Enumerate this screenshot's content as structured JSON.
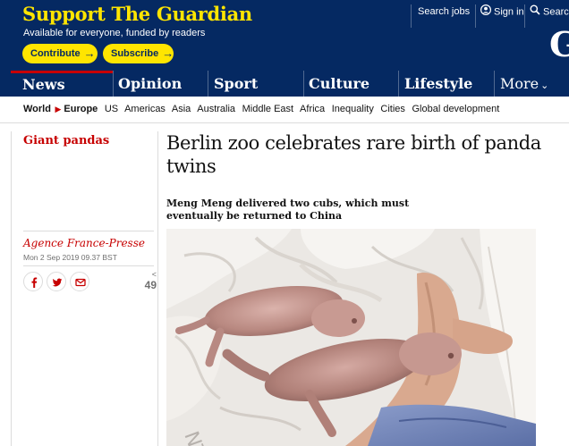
{
  "masthead": {
    "support_title": "Support The Guardian",
    "support_subtitle": "Available for everyone, funded by readers",
    "contribute_label": "Contribute",
    "subscribe_label": "Subscribe",
    "arrow_glyph": "→",
    "search_jobs": "Search jobs",
    "sign_in": "Sign in",
    "search": "Search",
    "logo_letter": "G",
    "colors": {
      "brand": "#052962",
      "accent": "#ffe500",
      "news_red": "#c70000"
    }
  },
  "pillars": {
    "items": [
      {
        "label": "News",
        "active": true
      },
      {
        "label": "Opinion",
        "active": false
      },
      {
        "label": "Sport",
        "active": false
      },
      {
        "label": "Culture",
        "active": false
      },
      {
        "label": "Lifestyle",
        "active": false
      }
    ],
    "more_label": "More",
    "more_icon": "chevron-down-icon"
  },
  "subnav": {
    "world": "World",
    "europe": "Europe",
    "items": [
      "US",
      "Americas",
      "Asia",
      "Australia",
      "Middle East",
      "Africa",
      "Inequality",
      "Cities",
      "Global development"
    ]
  },
  "article": {
    "section": "Giant pandas",
    "headline": "Berlin zoo celebrates rare birth of panda twins",
    "standfirst": "Meng Meng delivered two cubs, which must eventually be returned to China",
    "byline": "Agence France-Presse",
    "dateline": "Mon 2 Sep 2019 09.37 BST",
    "share_count": "49",
    "share_icons": [
      "facebook-icon",
      "twitter-icon",
      "email-icon"
    ]
  },
  "image": {
    "subject": "two newborn panda cubs on a white towel held by a gloved hand",
    "towel_letters": "NT"
  }
}
